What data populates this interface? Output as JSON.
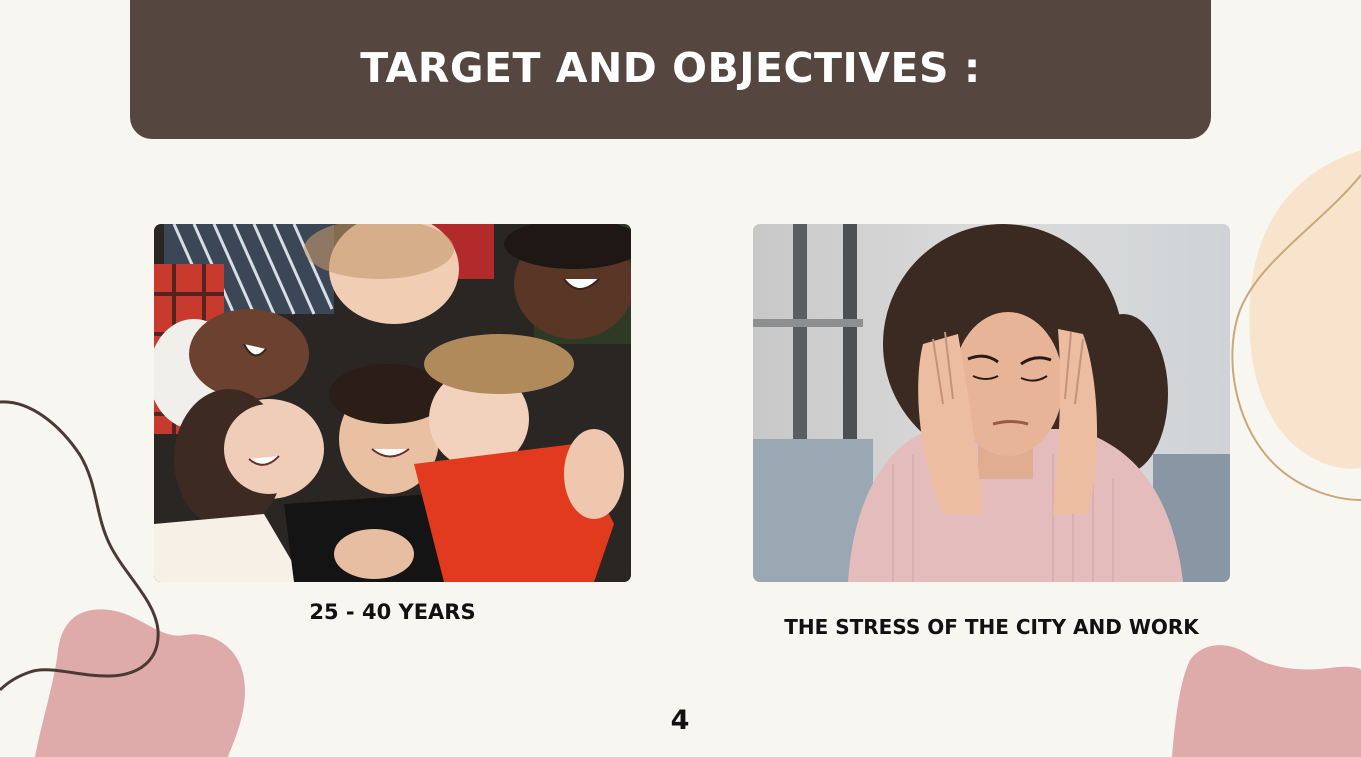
{
  "slide": {
    "title": "TARGET AND OBJECTIVES :",
    "page_number": "4"
  },
  "images": {
    "left": {
      "caption": "25 - 40 YEARS"
    },
    "right": {
      "caption": "THE STRESS OF THE CITY AND WORK"
    }
  },
  "colors": {
    "background": "#f8f6f1",
    "title_bar": "#554640",
    "title_text": "#ffffff",
    "pink_blob": "#dfaaaa",
    "peach_blob": "#f8e4cc",
    "dark_line": "#4a3a34",
    "tan_line": "#c9a77a"
  }
}
